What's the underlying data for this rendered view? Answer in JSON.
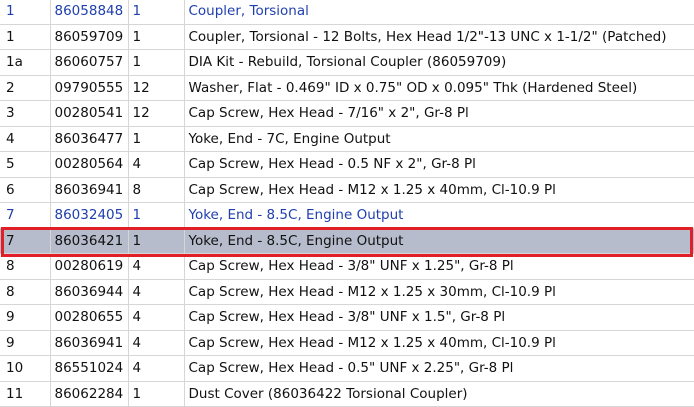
{
  "parts_list": {
    "rows": [
      {
        "ref": "1",
        "part": "86058848",
        "qty": "1",
        "desc": "Coupler, Torsional",
        "style": "link"
      },
      {
        "ref": "1",
        "part": "86059709",
        "qty": "1",
        "desc": "Coupler, Torsional - 12 Bolts, Hex Head 1/2\"-13 UNC x 1-1/2\" (Patched)",
        "style": "normal"
      },
      {
        "ref": "1a",
        "part": "86060757",
        "qty": "1",
        "desc": "DIA Kit - Rebuild, Torsional Coupler (86059709)",
        "style": "normal"
      },
      {
        "ref": "2",
        "part": "09790555",
        "qty": "12",
        "desc": "Washer, Flat - 0.469\" ID x 0.75\" OD x 0.095\" Thk (Hardened Steel)",
        "style": "normal"
      },
      {
        "ref": "3",
        "part": "00280541",
        "qty": "12",
        "desc": "Cap Screw, Hex Head - 7/16\" x 2\", Gr-8 Pl",
        "style": "normal"
      },
      {
        "ref": "4",
        "part": "86036477",
        "qty": "1",
        "desc": "Yoke, End - 7C, Engine Output",
        "style": "normal"
      },
      {
        "ref": "5",
        "part": "00280564",
        "qty": "4",
        "desc": "Cap Screw, Hex Head - 0.5 NF x 2\", Gr-8 Pl",
        "style": "normal"
      },
      {
        "ref": "6",
        "part": "86036941",
        "qty": "8",
        "desc": "Cap Screw, Hex Head - M12 x 1.25 x 40mm, Cl-10.9 Pl",
        "style": "normal"
      },
      {
        "ref": "7",
        "part": "86032405",
        "qty": "1",
        "desc": "Yoke, End - 8.5C, Engine Output",
        "style": "link"
      },
      {
        "ref": "7",
        "part": "86036421",
        "qty": "1",
        "desc": "Yoke, End - 8.5C, Engine Output",
        "style": "selected"
      },
      {
        "ref": "8",
        "part": "00280619",
        "qty": "4",
        "desc": "Cap Screw, Hex Head - 3/8\" UNF x 1.25\", Gr-8 Pl",
        "style": "normal"
      },
      {
        "ref": "8",
        "part": "86036944",
        "qty": "4",
        "desc": "Cap Screw, Hex Head - M12 x 1.25 x 30mm, Cl-10.9 Pl",
        "style": "normal"
      },
      {
        "ref": "9",
        "part": "00280655",
        "qty": "4",
        "desc": "Cap Screw, Hex Head - 3/8\" UNF x 1.5\", Gr-8 Pl",
        "style": "normal"
      },
      {
        "ref": "9",
        "part": "86036941",
        "qty": "4",
        "desc": "Cap Screw, Hex Head - M12 x 1.25 x 40mm, Cl-10.9 Pl",
        "style": "normal"
      },
      {
        "ref": "10",
        "part": "86551024",
        "qty": "4",
        "desc": "Cap Screw, Hex Head - 0.5\" UNF x 2.25\", Gr-8 Pl",
        "style": "normal"
      },
      {
        "ref": "11",
        "part": "86062284",
        "qty": "1",
        "desc": "Dust Cover (86036422 Torsional Coupler)",
        "style": "normal"
      }
    ]
  },
  "colors": {
    "link_text": "#1f3fae",
    "selected_row_bg": "#b7bccd",
    "highlight_border": "#e01f26",
    "grid_line": "#d6d6d6"
  }
}
